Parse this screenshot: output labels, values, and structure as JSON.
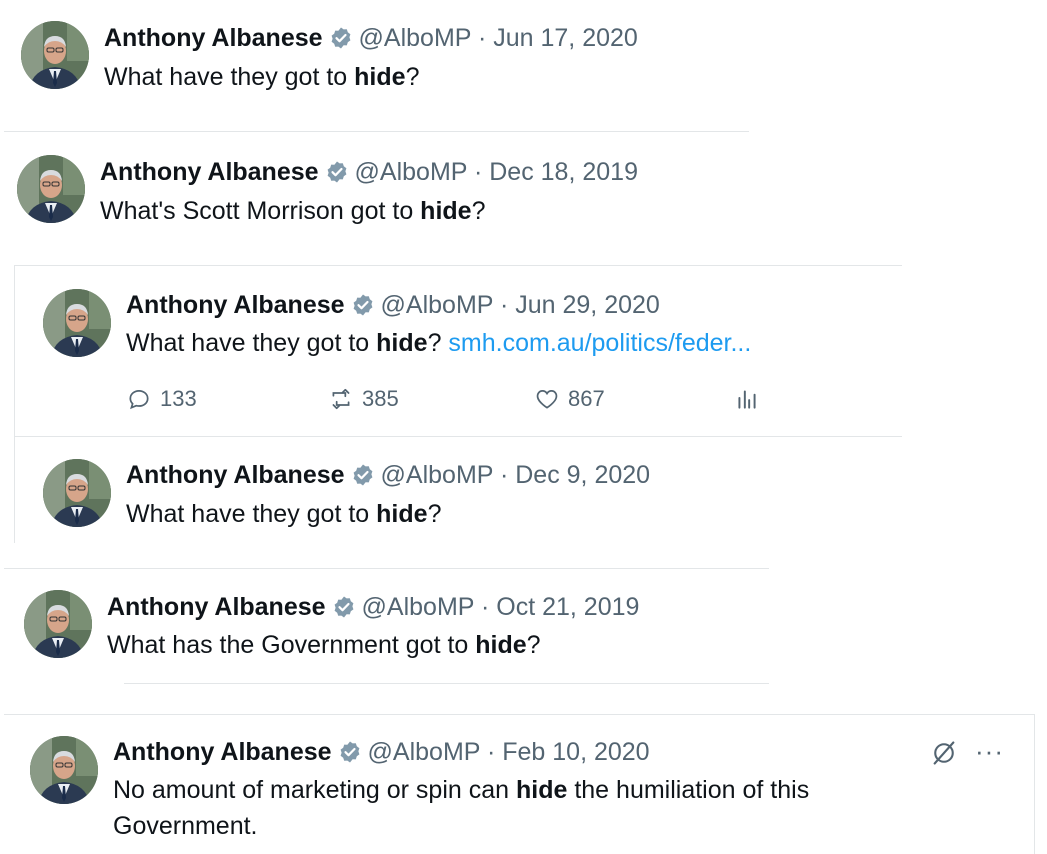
{
  "tweets": [
    {
      "name": "Anthony Albanese",
      "handle": "@AlboMP",
      "dot": "·",
      "date": "Jun 17, 2020",
      "text_before": "What have they got to ",
      "text_bold": "hide",
      "text_after": "?"
    },
    {
      "name": "Anthony Albanese",
      "handle": "@AlboMP",
      "dot": "·",
      "date": "Dec 18, 2019",
      "text_before": "What's Scott Morrison got to ",
      "text_bold": "hide",
      "text_after": "?"
    },
    {
      "name": "Anthony Albanese",
      "handle": "@AlboMP",
      "dot": "·",
      "date": "Jun 29, 2020",
      "text_before": "What have they got to ",
      "text_bold": "hide",
      "text_after": "? ",
      "link": "smh.com.au/politics/feder...",
      "replies": "133",
      "retweets": "385",
      "likes": "867"
    },
    {
      "name": "Anthony Albanese",
      "handle": "@AlboMP",
      "dot": "·",
      "date": "Dec 9, 2020",
      "text_before": "What have they got to ",
      "text_bold": "hide",
      "text_after": "?"
    },
    {
      "name": "Anthony Albanese",
      "handle": "@AlboMP",
      "dot": "·",
      "date": "Oct 21, 2019",
      "text_before": "What has the Government got to ",
      "text_bold": "hide",
      "text_after": "?"
    },
    {
      "name": "Anthony Albanese",
      "handle": "@AlboMP",
      "dot": "·",
      "date": "Feb 10, 2020",
      "text_before": "No amount of marketing or spin can ",
      "text_bold": "hide",
      "text_after": " the humiliation of this",
      "text_line2": "Government.",
      "more": "···"
    }
  ],
  "icons": {
    "verified": "verified-badge-icon",
    "reply": "reply-icon",
    "retweet": "retweet-icon",
    "like": "heart-icon",
    "views": "views-icon",
    "grok": "grok-icon",
    "more": "more-icon"
  },
  "colors": {
    "verified": "#829aab",
    "link": "#1d9bf0",
    "muted": "#536471"
  }
}
